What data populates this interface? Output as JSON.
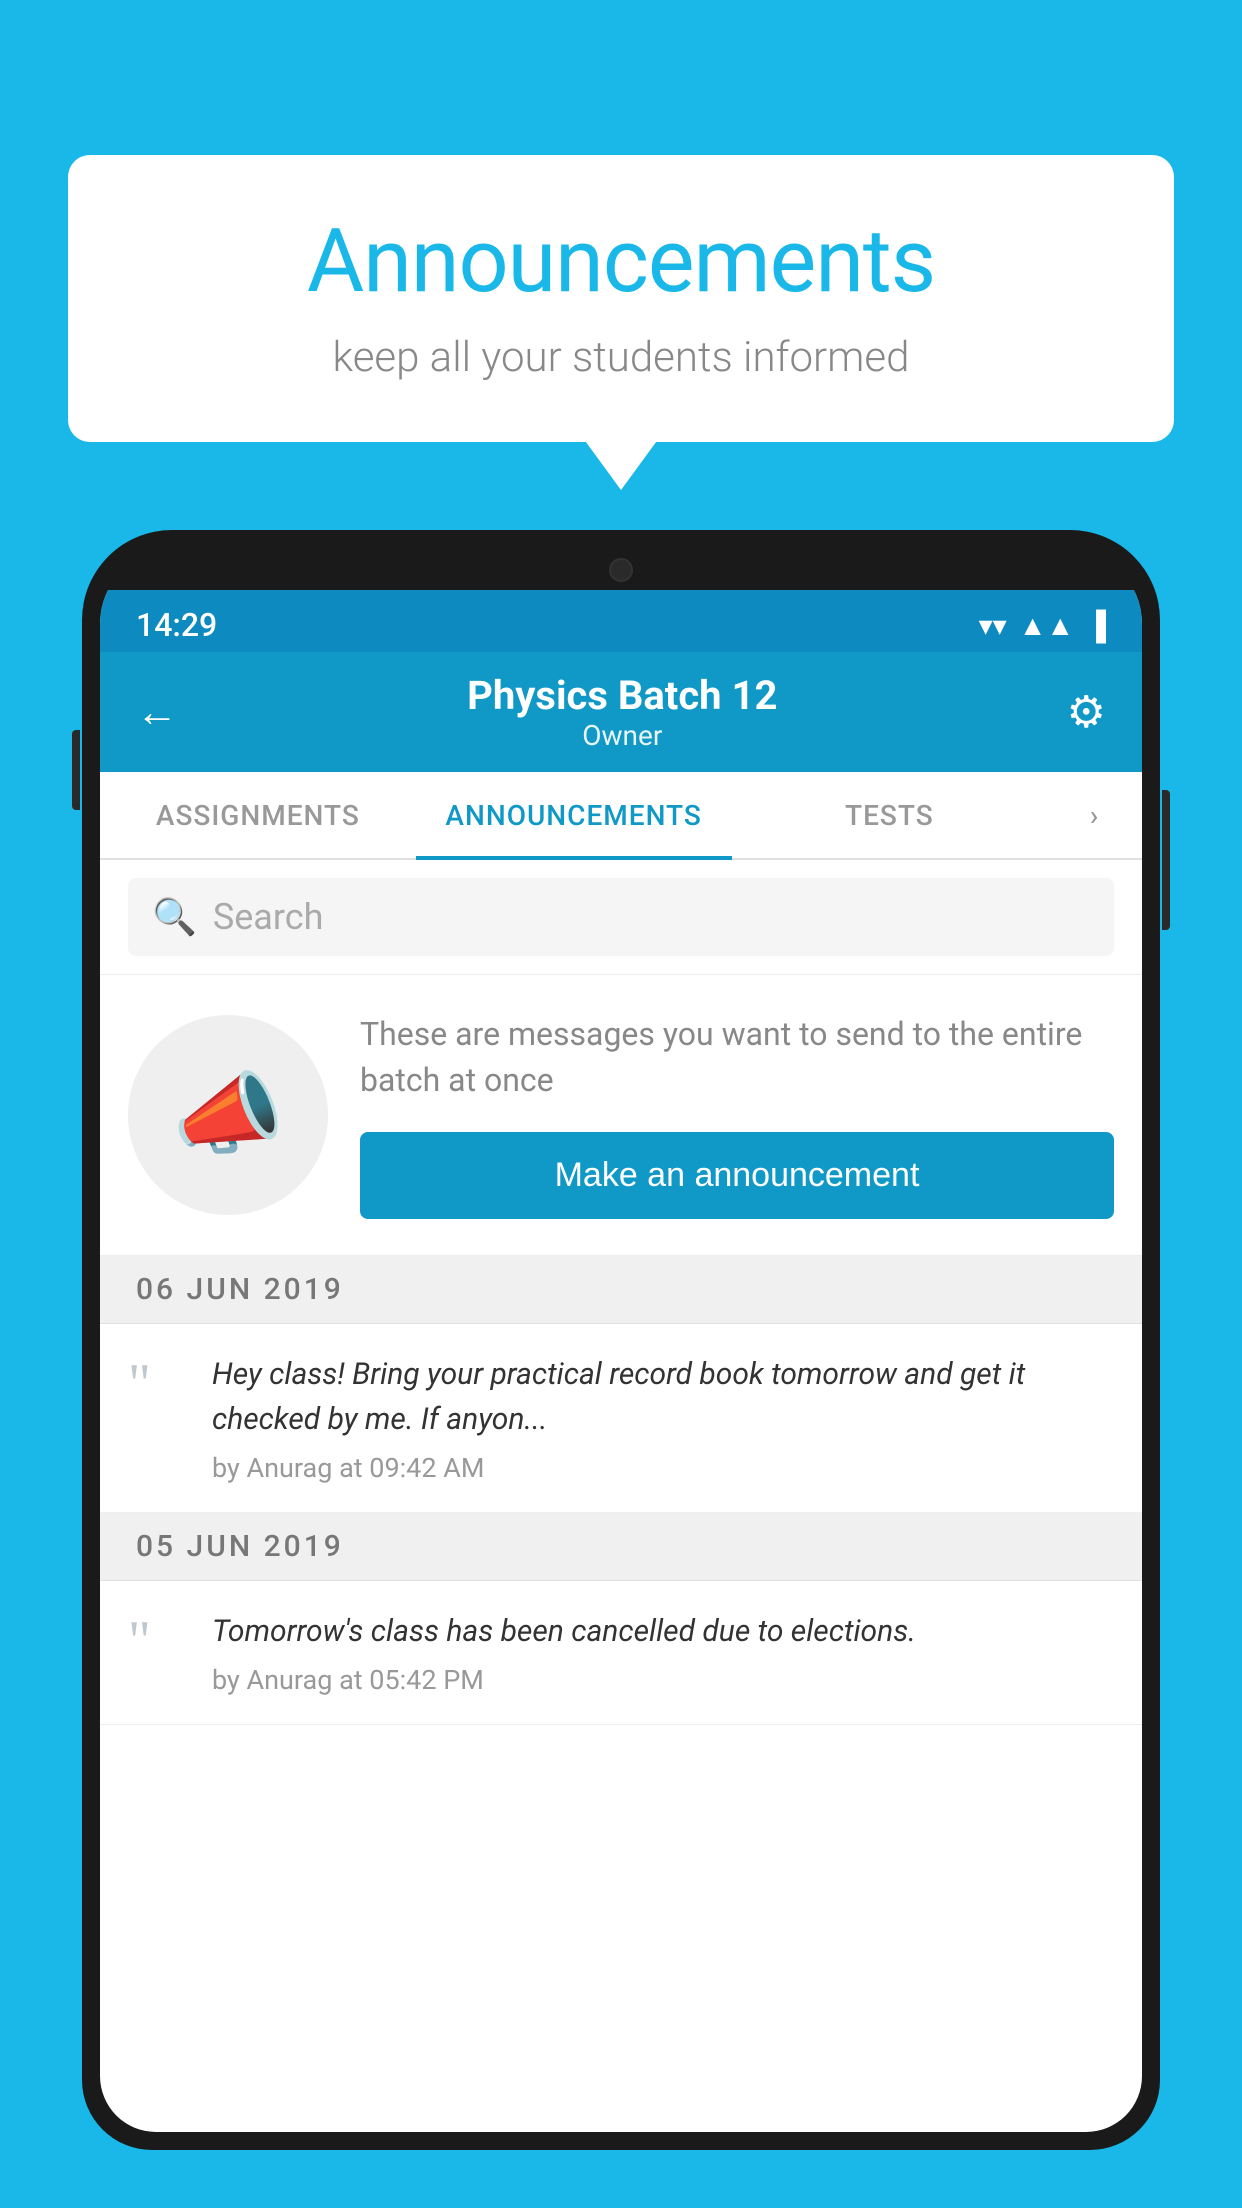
{
  "bubble": {
    "title": "Announcements",
    "subtitle": "keep all your students informed"
  },
  "status_bar": {
    "time": "14:29"
  },
  "header": {
    "title": "Physics Batch 12",
    "subtitle": "Owner"
  },
  "tabs": [
    {
      "label": "ASSIGNMENTS",
      "active": false
    },
    {
      "label": "ANNOUNCEMENTS",
      "active": true
    },
    {
      "label": "TESTS",
      "active": false
    },
    {
      "label": "...",
      "active": false
    }
  ],
  "search": {
    "placeholder": "Search"
  },
  "prompt": {
    "description": "These are messages you want to send to the entire batch at once",
    "button_label": "Make an announcement"
  },
  "announcements": [
    {
      "date": "06  JUN  2019",
      "text": "Hey class! Bring your practical record book tomorrow and get it checked by me. If anyon...",
      "meta": "by Anurag at 09:42 AM"
    },
    {
      "date": "05  JUN  2019",
      "text": "Tomorrow's class has been cancelled due to elections.",
      "meta": "by Anurag at 05:42 PM"
    }
  ],
  "colors": {
    "primary": "#1098c7",
    "bg": "#1ab8e8",
    "white": "#ffffff"
  }
}
